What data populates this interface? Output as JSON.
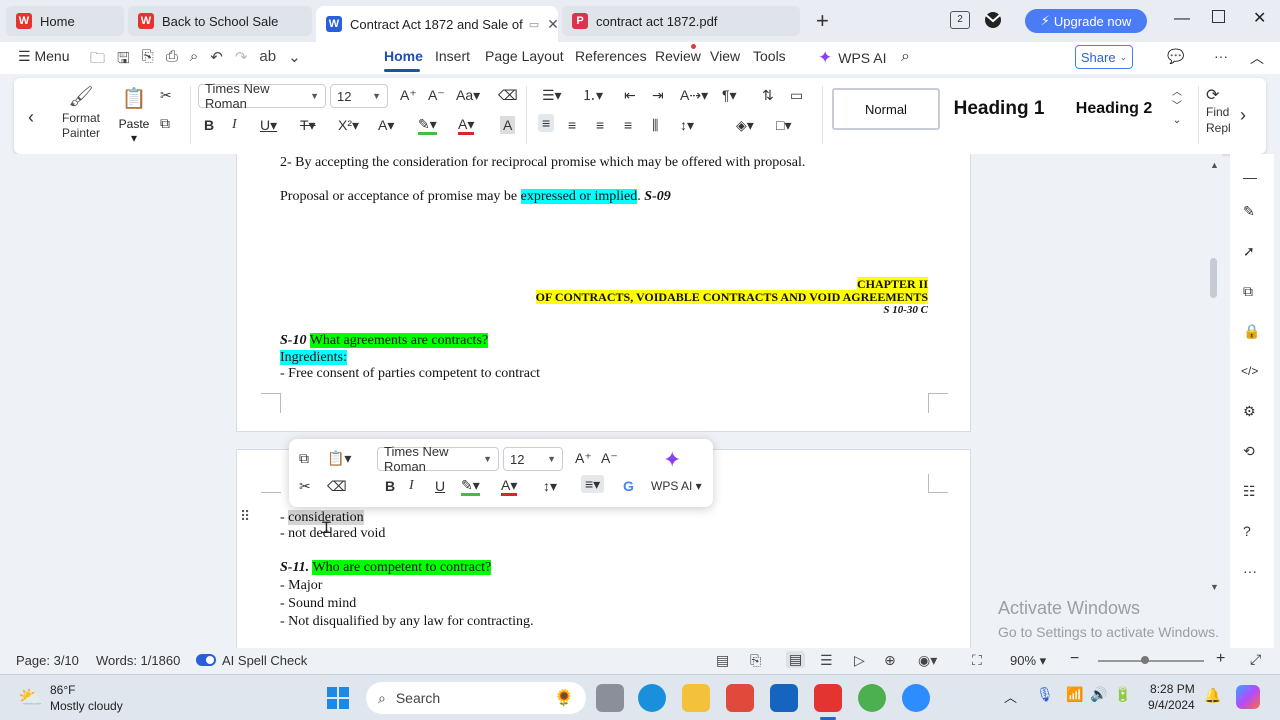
{
  "tabs": [
    {
      "label": "Home",
      "logo": "W",
      "color": "#e3342f"
    },
    {
      "label": "Back to School Sale",
      "logo": "W",
      "color": "#e3342f"
    },
    {
      "label": "Contract Act 1872 and Sale of",
      "logo": "W",
      "color": "#2b5fd9"
    },
    {
      "label": "contract act 1872.pdf",
      "logo": "P",
      "color": "#d9344b"
    }
  ],
  "upgrade_label": "Upgrade now",
  "menu": {
    "menu_label": "Menu",
    "items": [
      "Home",
      "Insert",
      "Page Layout",
      "References",
      "Review",
      "View",
      "Tools"
    ],
    "wps_ai": "WPS AI",
    "share": "Share"
  },
  "ribbon": {
    "format_painter": "Format Painter",
    "format_painter_1": "Format",
    "format_painter_2": "Painter",
    "paste": "Paste",
    "font": "Times New Roman",
    "size": "12",
    "styles": [
      "Normal",
      "Heading 1",
      "Heading 2"
    ],
    "find_1": "Find",
    "find_2": "Repl"
  },
  "doc": {
    "line_1": "2-  By accepting the consideration for reciprocal promise which may be offered with proposal.",
    "line_2a": "Proposal or acceptance of promise may be ",
    "line_2b": "expressed or implied",
    "line_2c": ". ",
    "line_2d": "S-09",
    "chapter": "CHAPTER II",
    "chapter_title": "OF CONTRACTS, VOIDABLE CONTRACTS AND VOID AGREEMENTS",
    "chapter_sub": "S 10-30 C",
    "s10": "S-10",
    "s10_q": "What agreements are contracts?",
    "ingredients": "Ingredients:",
    "ing_1": "- Free consent of parties competent to contract",
    "p2_dash": "- ",
    "p2_cons": "consideration",
    "p2_void": "- not declared void",
    "s11": "S-11.",
    "s11_q": "Who are competent to contract?",
    "s11_a": "- Major",
    "s11_b": "- Sound mind",
    "s11_c": "- Not disqualified by any law for contracting."
  },
  "floatbar": {
    "font": "Times New Roman",
    "size": "12",
    "wps_ai": "WPS AI"
  },
  "watermark": {
    "title": "Activate Windows",
    "sub": "Go to Settings to activate Windows."
  },
  "status": {
    "page": "Page: 3/10",
    "words": "Words: 1/1860",
    "spell": "AI Spell Check",
    "zoom": "90%"
  },
  "taskbar": {
    "temp": "86°F",
    "weather": "Mostly cloudy",
    "search": "Search",
    "time": "8:28 PM",
    "date": "9/4/2024"
  }
}
